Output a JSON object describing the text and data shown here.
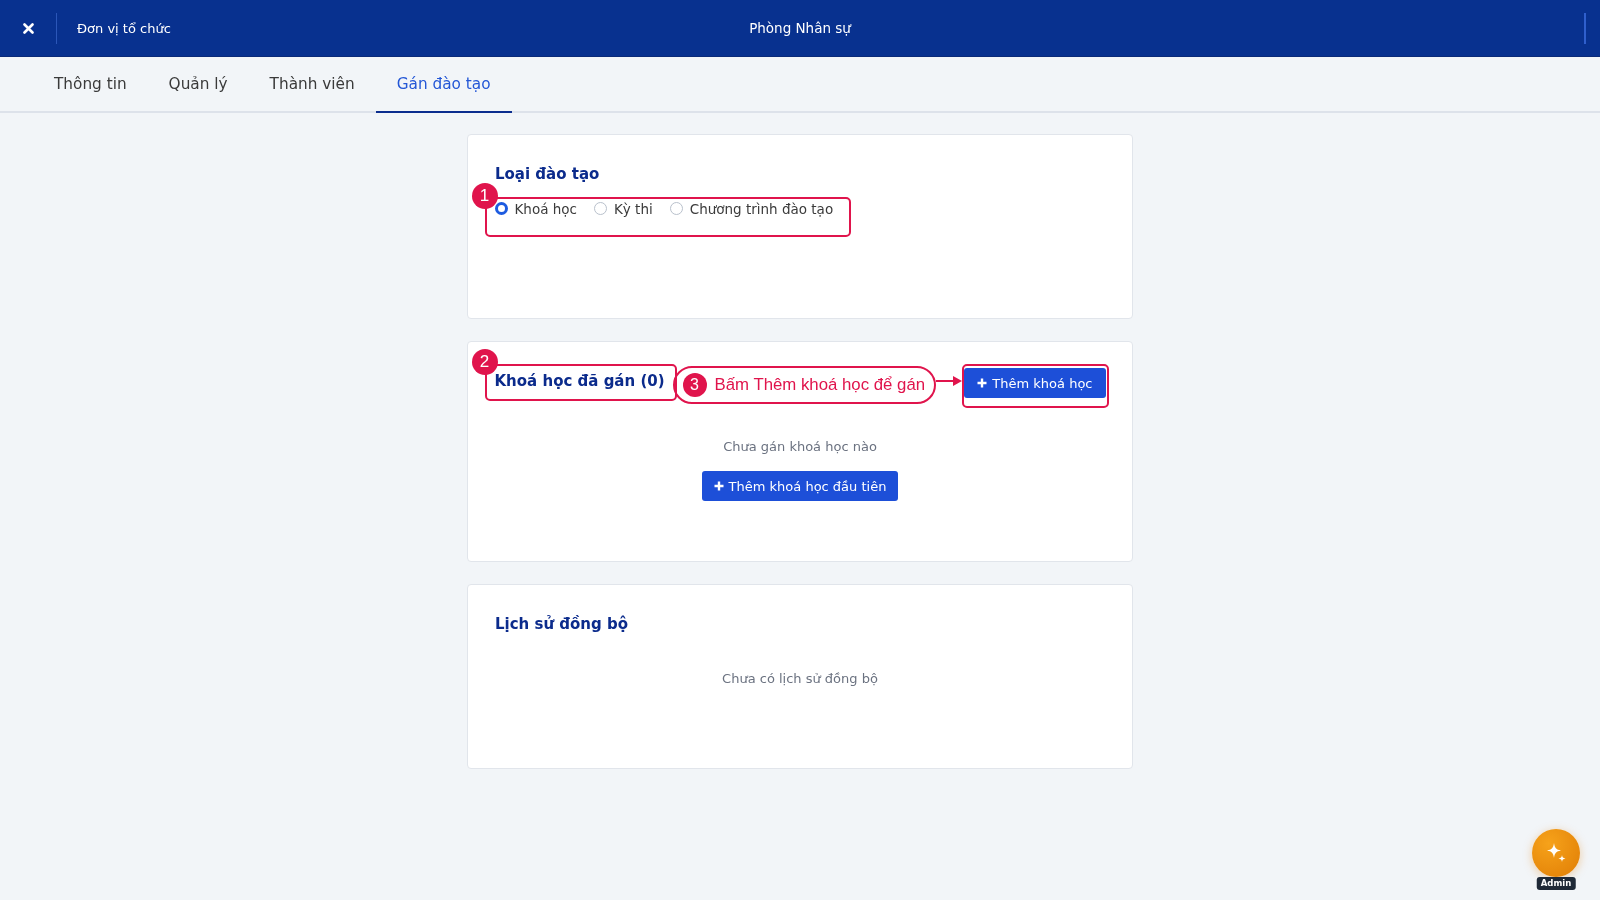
{
  "header": {
    "breadcrumb": "Đơn vị tổ chức",
    "title": "Phòng Nhân sự"
  },
  "tabs": [
    {
      "label": "Thông tin",
      "selected": false
    },
    {
      "label": "Quản lý",
      "selected": false
    },
    {
      "label": "Thành viên",
      "selected": false
    },
    {
      "label": "Gán đào tạo",
      "selected": true
    }
  ],
  "sections": [
    {
      "kind": "choice",
      "title": "Loại đào tạo",
      "step": "1",
      "options": [
        {
          "label": "Khoá học",
          "selected": true
        },
        {
          "label": "Kỳ thi",
          "selected": false
        },
        {
          "label": "Chương trình đào tạo",
          "selected": false
        }
      ]
    },
    {
      "kind": "assigned",
      "title": "Khoá học đã gán (0)",
      "step": "2",
      "callout": {
        "step": "3",
        "text": "Bấm Thêm khoá học để gán"
      },
      "action": {
        "label": "Thêm khoá học",
        "highlighted": true
      },
      "empty_text": "Chưa gán khoá học nào",
      "empty_action": "Thêm khoá học đầu tiên"
    },
    {
      "kind": "history",
      "title": "Lịch sử đồng bộ",
      "empty_text": "Chưa có lịch sử đồng bộ"
    }
  ],
  "assistant": {
    "label": "Admin"
  }
}
